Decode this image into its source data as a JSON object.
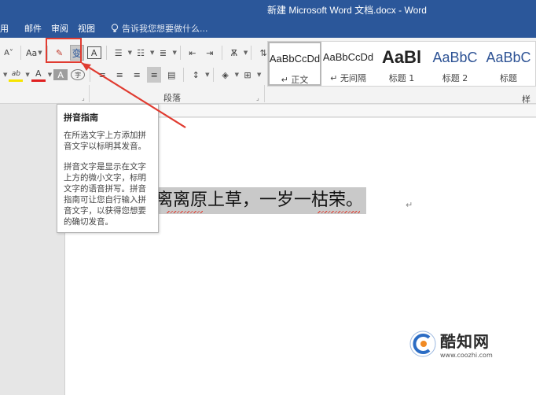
{
  "window": {
    "title": "新建 Microsoft Word 文档.docx - Word"
  },
  "tabs": [
    {
      "label": "用"
    },
    {
      "label": "邮件"
    },
    {
      "label": "审阅"
    },
    {
      "label": "视图"
    }
  ],
  "tell_me": {
    "placeholder": "告诉我您想要做什么..."
  },
  "ribbon": {
    "font_group": {
      "font_case_label": "Aa",
      "phonetic_label": "变",
      "char_border_label": "A",
      "font_color_label": "A",
      "char_shading_label": "A",
      "highlight_label": "ab",
      "enclose_char_label": "字"
    },
    "paragraph_group_label": "段落",
    "styles_group_label": "样式",
    "styles": [
      {
        "preview": "AaBbCcDd",
        "name": "正文",
        "selected": true
      },
      {
        "preview": "AaBbCcDd",
        "name": "无间隔",
        "selected": false
      },
      {
        "preview": "AaBl",
        "name": "标题 1",
        "selected": false
      },
      {
        "preview": "AaBbC",
        "name": "标题 2",
        "selected": false
      },
      {
        "preview": "AaBbC",
        "name": "标题",
        "selected": false
      }
    ]
  },
  "tooltip": {
    "title": "拼音指南",
    "para1": "在所选文字上方添加拼音文字以标明其发音。",
    "para2": "拼音文字是显示在文字上方的微小文字，标明文字的语音拼写。拼音指南可让您自行输入拼音文字，以获得您想要的确切发音。"
  },
  "document": {
    "text": "离离原上草，一岁一枯荣。"
  },
  "watermark": {
    "name": "酷知网",
    "url": "www.coozhi.com"
  },
  "colors": {
    "title_bar": "#2b579a",
    "annotation_red": "#e03c31",
    "selection_gray": "#c9c9c9"
  }
}
